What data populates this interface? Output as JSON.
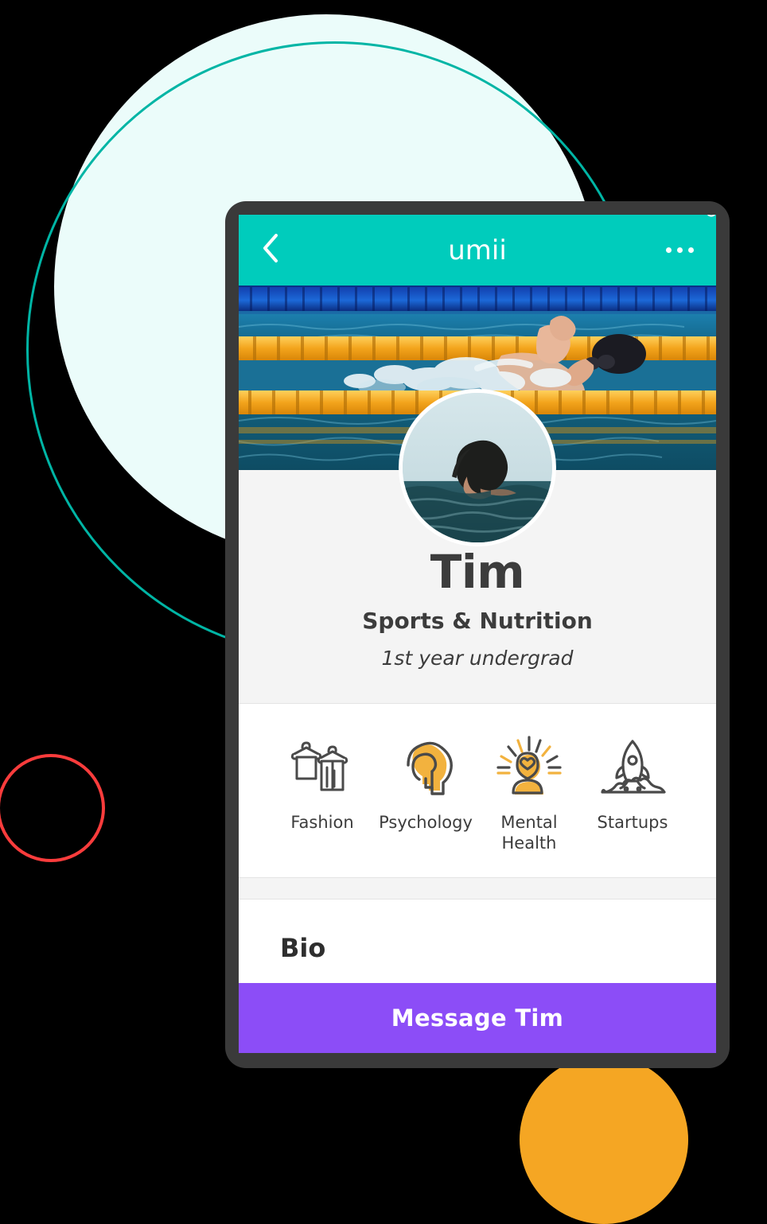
{
  "background": {
    "canvas_color": "#000000",
    "shapes": [
      {
        "name": "mint-circle",
        "type": "filled-circle",
        "color": "#EBFCFA"
      },
      {
        "name": "teal-ring",
        "type": "outline-circle",
        "color": "#00B5A5"
      },
      {
        "name": "red-ring",
        "type": "outline-circle",
        "color": "#FA3C3C"
      },
      {
        "name": "orange-circle",
        "type": "filled-circle",
        "color": "#F5A623"
      }
    ]
  },
  "device": {
    "frame_color": "#3A3A3A",
    "screen_background": "#FFFFFF"
  },
  "appbar": {
    "background": "#00CCBC",
    "back_icon": "chevron-left-icon",
    "brand": "umii",
    "more_icon": "more-horizontal-icon"
  },
  "cover": {
    "alt": "swimmer-in-pool-photo",
    "water_color": "#1E7FA8",
    "lane_rope_color": "#F5A623",
    "top_lane_color": "#0D3FA0"
  },
  "profile": {
    "avatar": "person-swimming-in-sea-photo",
    "name": "Tim",
    "subject": "Sports & Nutrition",
    "year": "1st year undergrad"
  },
  "interests": {
    "items": [
      {
        "label": "Fashion",
        "icon": "clothes-hanger-icon"
      },
      {
        "label": "Psychology",
        "icon": "head-profile-icon"
      },
      {
        "label": "Mental Health",
        "icon": "person-with-heart-rays-icon"
      },
      {
        "label": "Startups",
        "icon": "rocket-icon"
      }
    ],
    "accent_color": "#F2B23E",
    "outline_color": "#4A4A4A"
  },
  "bio": {
    "title": "Bio"
  },
  "cta": {
    "label": "Message Tim",
    "background": "#8C4DF7"
  }
}
